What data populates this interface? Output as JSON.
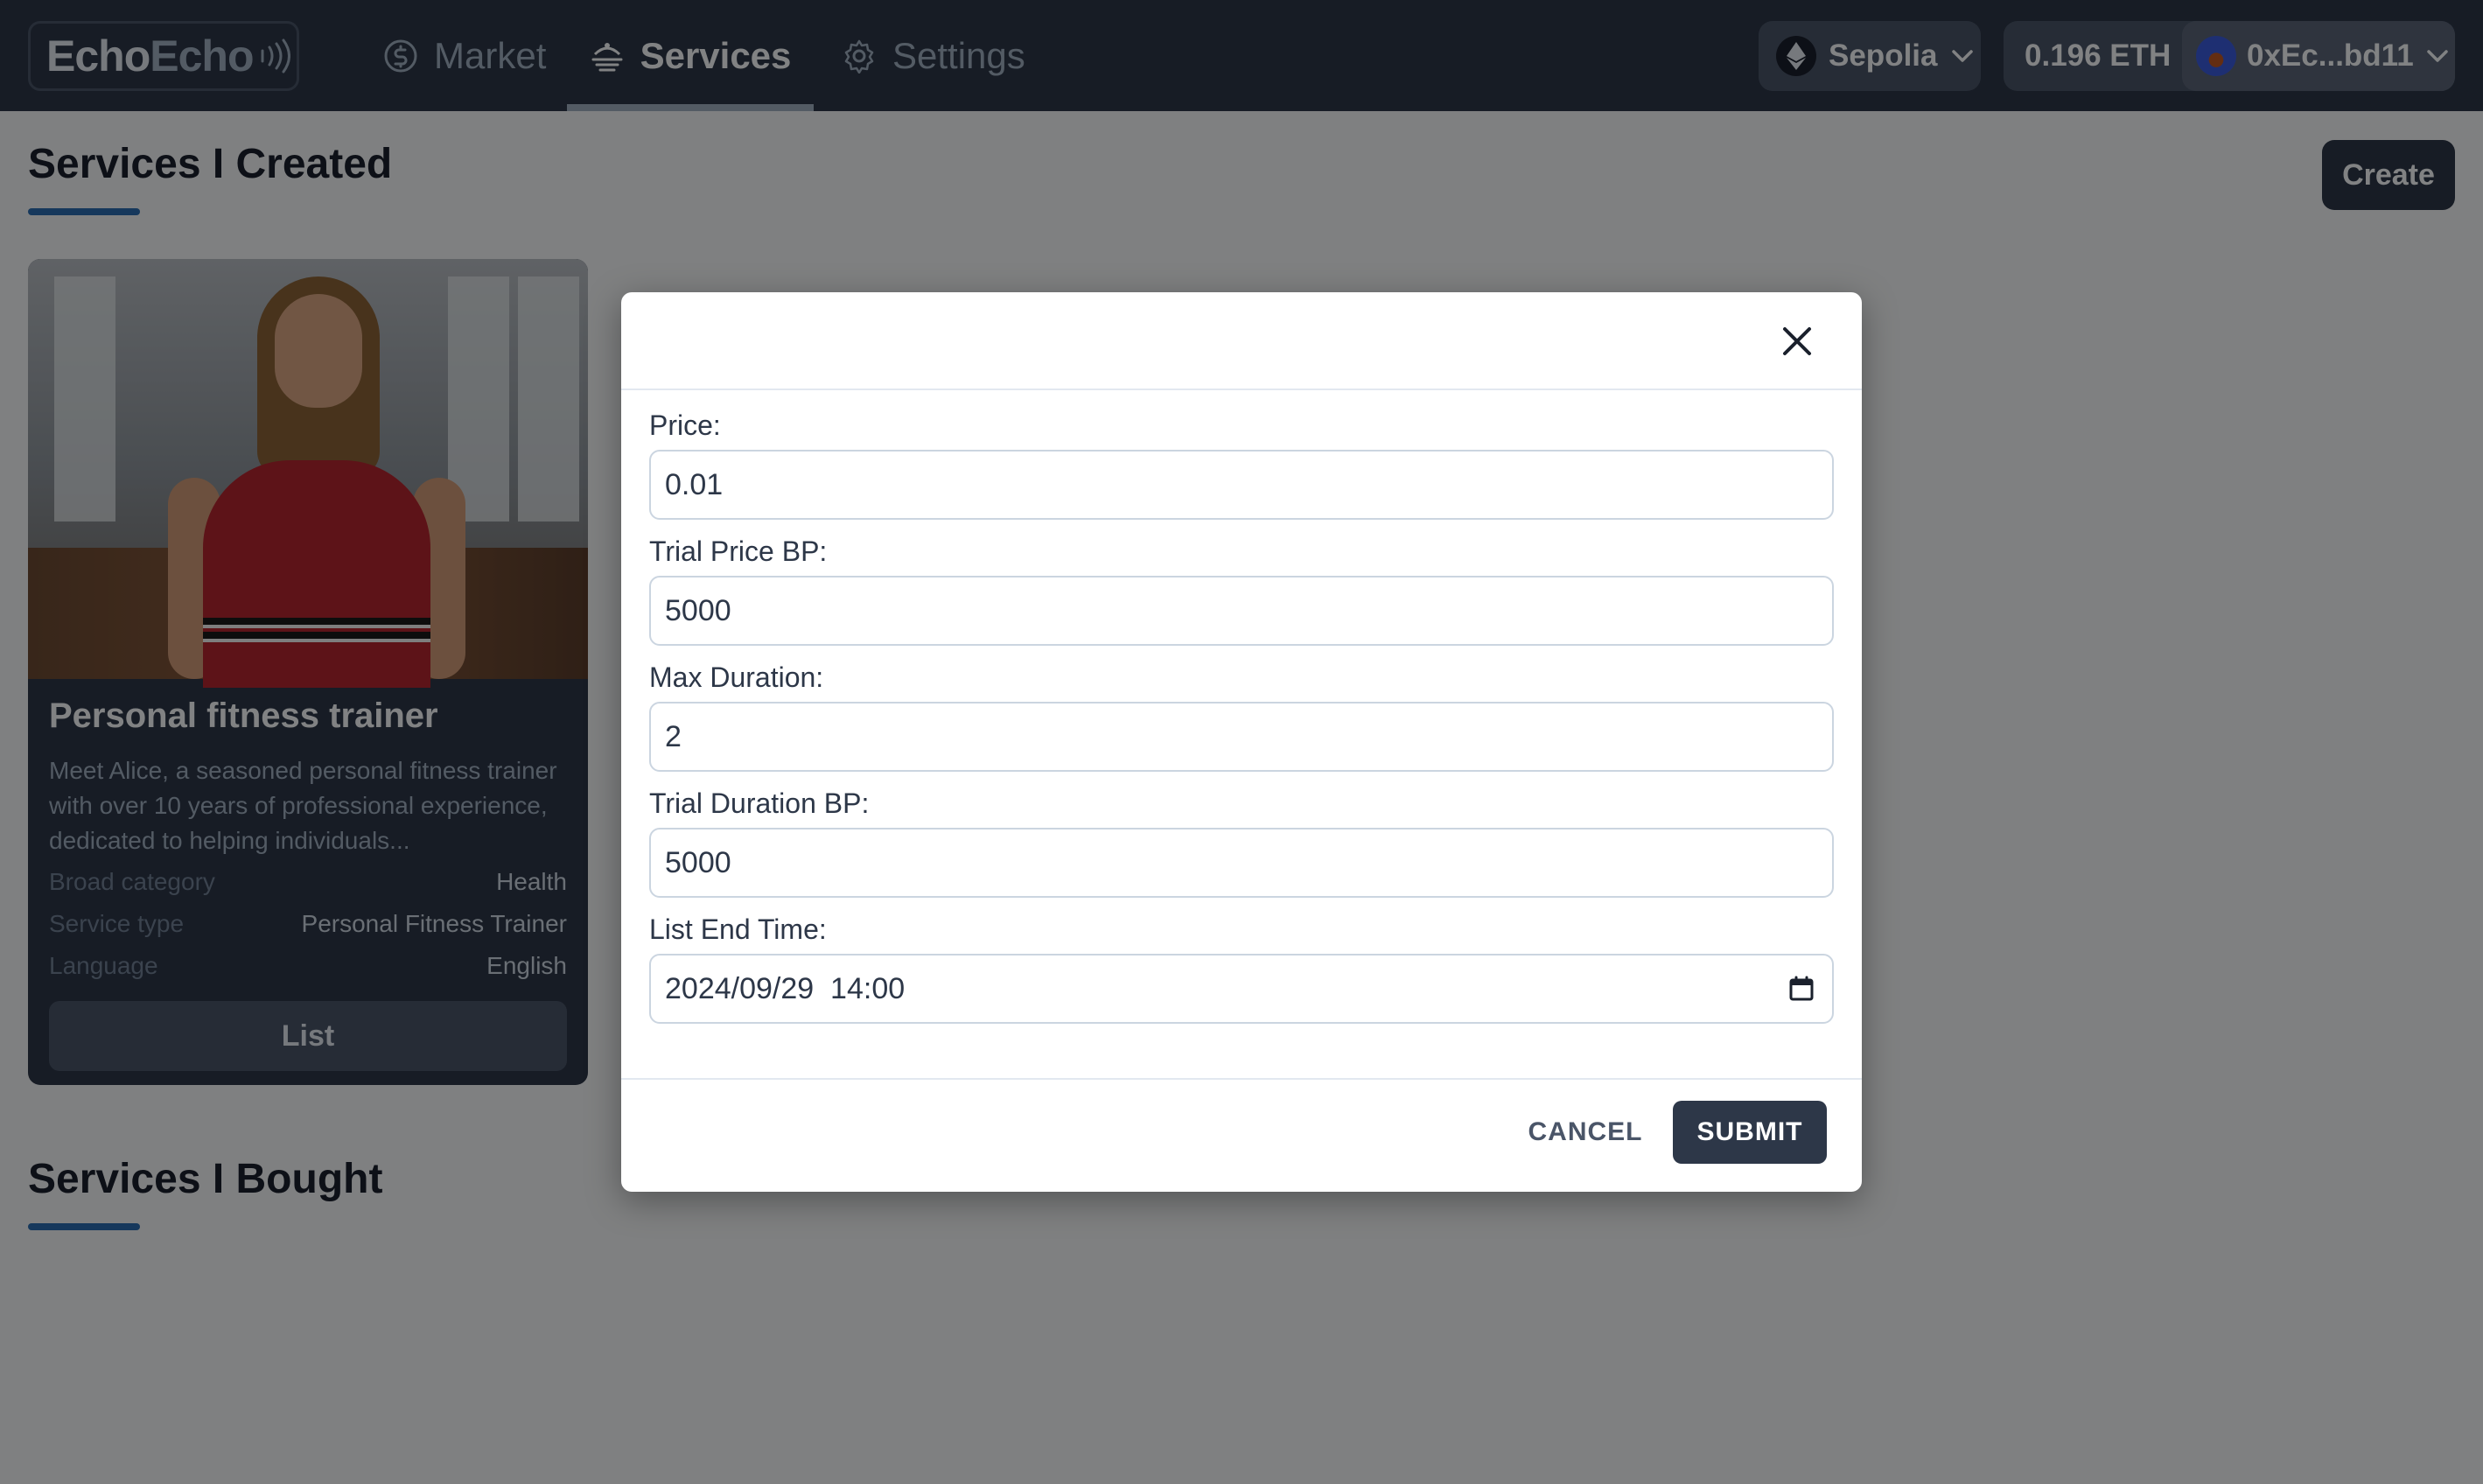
{
  "app": {
    "logo_part1": "Echo",
    "logo_part2": "Echo"
  },
  "nav": {
    "market": "Market",
    "services": "Services",
    "settings": "Settings",
    "active": "Services"
  },
  "network": {
    "name": "Sepolia"
  },
  "wallet": {
    "balance": "0.196 ETH",
    "address": "0xEc...bd11"
  },
  "page": {
    "created_title": "Services I Created",
    "create_button": "Create",
    "bought_title": "Services I Bought"
  },
  "card": {
    "title": "Personal fitness trainer",
    "description": "Meet Alice, a seasoned personal fitness trainer with over 10 years of professional experience, dedicated to helping individuals...",
    "meta": [
      {
        "label": "Broad category",
        "value": "Health"
      },
      {
        "label": "Service type",
        "value": "Personal Fitness Trainer"
      },
      {
        "label": "Language",
        "value": "English"
      }
    ],
    "list_button": "List"
  },
  "modal": {
    "fields": [
      {
        "label": "Price:",
        "value": "0.01"
      },
      {
        "label": "Trial Price BP:",
        "value": "5000"
      },
      {
        "label": "Max Duration:",
        "value": "2"
      },
      {
        "label": "Trial Duration BP:",
        "value": "5000"
      },
      {
        "label": "List End Time:",
        "value": "2024/09/29  14:00"
      }
    ],
    "cancel": "CANCEL",
    "submit": "SUBMIT"
  },
  "colors": {
    "nav_bg": "#2d3748",
    "accent_underline": "#2b6cb0",
    "primary_button": "#2d3748"
  },
  "icons": [
    "dollar-circle-icon",
    "services-stack-icon",
    "gear-icon",
    "sound-waves-icon",
    "ethereum-icon",
    "chevron-down-icon",
    "close-icon",
    "calendar-icon"
  ]
}
